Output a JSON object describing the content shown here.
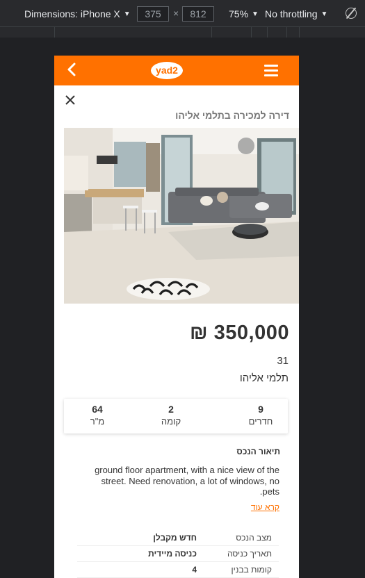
{
  "devtools": {
    "device_label": "Dimensions: iPhone X",
    "width": "375",
    "height": "812",
    "times": "×",
    "zoom": "75%",
    "throttle": "No throttling",
    "caret": "▼"
  },
  "app": {
    "logo_text": "yad2",
    "accent_color": "#ff7100"
  },
  "listing": {
    "title": "דירה למכירה בתלמי אליהו",
    "price": "350,000 ₪",
    "street_number": "31",
    "street_name": "תלמי אליהו",
    "photo_description_icon": "apartment-photo"
  },
  "stats": [
    {
      "value": "9",
      "label": "חדרים"
    },
    {
      "value": "2",
      "label": "קומה"
    },
    {
      "value": "64",
      "label": "מ\"ר"
    }
  ],
  "description": {
    "heading": "תיאור הנכס",
    "body": "ground floor apartment, with a nice view of the street. Need renovation, a lot of windows, no pets.",
    "read_more": "קרא עוד"
  },
  "details": [
    {
      "key": "מצב הנכס",
      "value": "חדש מקבלן"
    },
    {
      "key": "תאריך כניסה",
      "value": "כניסה מיידית"
    },
    {
      "key": "קומות בבנין",
      "value": "4"
    }
  ]
}
